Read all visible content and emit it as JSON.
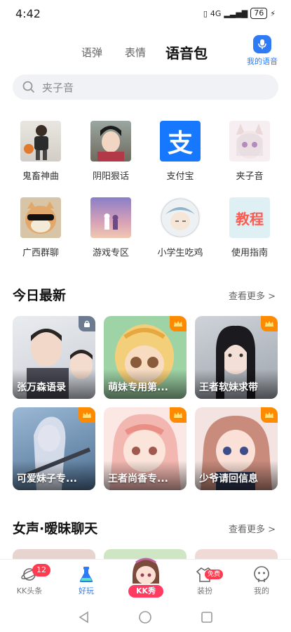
{
  "status_bar": {
    "time": "4:42",
    "network": "4G",
    "battery": "76"
  },
  "top_tabs": [
    {
      "label": "语弹"
    },
    {
      "label": "表情"
    },
    {
      "label": "语音包"
    }
  ],
  "my_voice": {
    "label": "我的语音"
  },
  "search": {
    "placeholder": "夹子音"
  },
  "categories": [
    {
      "label": "鬼畜神曲"
    },
    {
      "label": "阴阳狠话"
    },
    {
      "label": "支付宝",
      "icon_text": "支"
    },
    {
      "label": "夹子音"
    },
    {
      "label": "广西群聊"
    },
    {
      "label": "游戏专区"
    },
    {
      "label": "小学生吃鸡"
    },
    {
      "label": "使用指南",
      "icon_text": "教程"
    }
  ],
  "section_today": {
    "title": "今日最新",
    "more": "查看更多 >",
    "cards": [
      {
        "title": "张万森语录",
        "badge": "lock"
      },
      {
        "title": "萌妹专用第...",
        "badge": "crown"
      },
      {
        "title": "王者软妹求带",
        "badge": "crown"
      },
      {
        "title": "可爱妹子专...",
        "badge": "crown"
      },
      {
        "title": "王者尚香专...",
        "badge": "crown"
      },
      {
        "title": "少爷请回信息",
        "badge": "crown"
      }
    ]
  },
  "section_female": {
    "title": "女声·暧昧聊天",
    "more": "查看更多 >"
  },
  "bottom_nav": [
    {
      "label": "KK头条",
      "badge": "12"
    },
    {
      "label": "好玩"
    },
    {
      "label": "KK秀"
    },
    {
      "label": "装扮",
      "badge": "免费"
    },
    {
      "label": "我的"
    }
  ],
  "colors": {
    "accent": "#2f7bf5",
    "highlight": "#ffd93b",
    "badge_red": "#ff3b4f",
    "crown_orange": "#ff8a00"
  }
}
